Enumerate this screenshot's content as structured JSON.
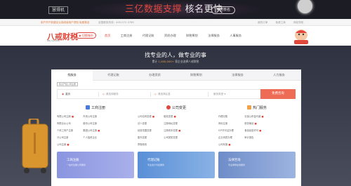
{
  "banner": {
    "tag": "慧得机",
    "headline_red": "三亿数据支撑",
    "headline_white": "核名更快",
    "button": "免费核名"
  },
  "topbar": {
    "left": "用户开户前建议认真阅读用户须知 免费核名",
    "middle": "全国服务热线：400-072-3786",
    "links": [
      "我的订单",
      "免费工商",
      "网站导航"
    ]
  },
  "header": {
    "logo": "八戒财税",
    "logo_sub": "ZBJ CAISHUI",
    "city": "切换城市",
    "nav": [
      "首页",
      "工商注册",
      "代理记账",
      "资质办理",
      "财税筹划",
      "法律服务",
      "人事服务"
    ]
  },
  "hero": {
    "title": "找专业的人，做专业的事",
    "subtitle_prefix": "累计",
    "subtitle_highlight": "1,000,000+",
    "subtitle_suffix": "家企业选择八戒财税"
  },
  "tabs": [
    "找服务",
    "代理记账",
    "办理资质",
    "财税筹划",
    "法律服务",
    "人力服务"
  ],
  "subtag": "知识产权公司注册",
  "search": {
    "city": "重庆",
    "field2": "请选择服务",
    "field3": "请选择区县",
    "field4": "服务类型",
    "button": "免费咨询"
  },
  "columns": [
    {
      "title": "工商注册",
      "icon_color": "#4a7bd8",
      "links": [
        "有限公司注册",
        "外资公司注册",
        "有限合伙公司",
        "股份公司注册",
        "个体工商户注册",
        "集团公司注册",
        "分公司注册",
        "个人独资企业",
        "公司注销"
      ],
      "hot": [
        true,
        false,
        false,
        false,
        false,
        true,
        false,
        false,
        true
      ]
    },
    {
      "title": "公司变更",
      "icon_color": "#e0483c",
      "links": [
        "公司名称变更",
        "股权变更",
        "法人变更",
        "注册地址变更",
        "经营范围变更",
        "注册资本变更",
        "股东变更",
        "公司类型变更",
        "章程修改"
      ],
      "hot": [
        true,
        true,
        false,
        false,
        false,
        true,
        false,
        false,
        false
      ]
    },
    {
      "title": "热门服务",
      "icon_color": "#f0a14a",
      "links": [
        "代理记账",
        "社保公积金代缴",
        "商标注册",
        "税务筹划",
        "ICP许可证办理",
        "食品经营许可",
        "企业资质办理",
        "审计报告",
        "公司年报"
      ],
      "hot": [
        false,
        true,
        false,
        true,
        false,
        true,
        false,
        false,
        true
      ]
    }
  ],
  "promos": [
    {
      "title": "工商注册",
      "subtitle": "一站式注册公司服务",
      "color": "#7d8bd6"
    },
    {
      "title": "代理记账",
      "subtitle": "专业会计为您服务",
      "color": "#5a92d8"
    },
    {
      "title": "法律咨询",
      "subtitle": "专业律师在线服务",
      "color": "#6f8ec9"
    }
  ]
}
